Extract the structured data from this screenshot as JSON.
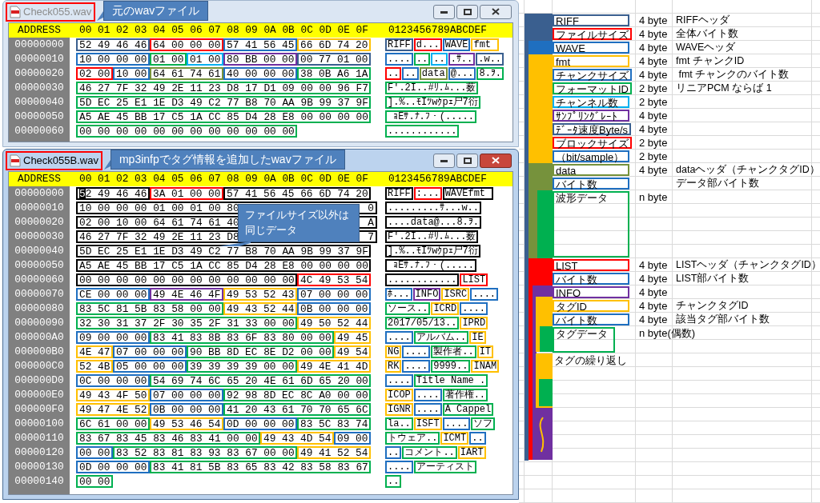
{
  "windows": [
    {
      "title": "Check055.wav",
      "active": false,
      "callout": "元のwavファイル",
      "header": {
        "address": "ADDRESS",
        "hex": "00 01 02 03 04 05 06 07 08 09 0A 0B 0C 0D 0E 0F",
        "ascii": "0123456789ABCDEF"
      },
      "rows": [
        {
          "address": "00000000",
          "hex": [
            {
              "text": "52 49 46 46",
              "color": "#3a5f8f"
            },
            {
              "text": "64 00 00 00",
              "color": "#ff0000"
            },
            {
              "text": "57 41 56 45",
              "color": "#1f6fc0"
            },
            {
              "text": "66 6D 74 20",
              "color": "#ffc000"
            }
          ],
          "ascii": [
            {
              "text": "RIFF",
              "color": "#3a5f8f"
            },
            {
              "text": "d...",
              "color": "#ff0000"
            },
            {
              "text": "WAVE",
              "color": "#1f6fc0"
            },
            {
              "text": "fmt ",
              "color": "#ffc000"
            }
          ]
        },
        {
          "address": "00000010",
          "hex": [
            {
              "text": "10 00 00 00",
              "color": "#1f6fc0"
            },
            {
              "text": "01 00",
              "color": "#00b050"
            },
            {
              "text": "01 00",
              "color": "#00b0f0"
            },
            {
              "text": "80 BB 00 00",
              "color": "#7030a0"
            },
            {
              "text": "00 77 01 00",
              "color": "#3a5f8f"
            }
          ],
          "ascii": [
            {
              "text": "....",
              "color": "#1f6fc0"
            },
            {
              "text": "..",
              "color": "#00b050"
            },
            {
              "text": "..",
              "color": "#00b0f0"
            },
            {
              "text": ".ｻ..",
              "color": "#7030a0"
            },
            {
              "text": ".w..",
              "color": "#3a5f8f"
            }
          ]
        },
        {
          "address": "00000020",
          "hex": [
            {
              "text": "02 00",
              "color": "#ff0000"
            },
            {
              "text": "10 00",
              "color": "#1f6fc0"
            },
            {
              "text": "64 61 74 61",
              "color": "#76923c"
            },
            {
              "text": "40 00 00 00",
              "color": "#1f6fc0"
            },
            {
              "text": "38 0B A6 1A",
              "color": "#00b050"
            }
          ],
          "ascii": [
            {
              "text": "..",
              "color": "#ff0000"
            },
            {
              "text": "..",
              "color": "#1f6fc0"
            },
            {
              "text": "data",
              "color": "#76923c"
            },
            {
              "text": "@...",
              "color": "#1f6fc0"
            },
            {
              "text": "8.ｦ.",
              "color": "#00b050"
            }
          ]
        },
        {
          "address": "00000030",
          "hex": [
            {
              "text": "46 27 7F 32 49 2E 11 23 D8 17 D1 09 00 00 96 F7",
              "color": "#00b050"
            }
          ],
          "ascii": [
            {
              "text": "F'.2I..#ﾘ.ﾑ...薮",
              "color": "#00b050"
            }
          ]
        },
        {
          "address": "00000040",
          "hex": [
            {
              "text": "5D EC 25 E1 1E D3 49 C2 77 B8 70 AA 9B 99 37 9F",
              "color": "#00b050"
            }
          ],
          "ascii": [
            {
              "text": "].%..ﾓIﾂwｸpｪ尸7衍",
              "color": "#00b050"
            }
          ]
        },
        {
          "address": "00000050",
          "hex": [
            {
              "text": "A5 AE 45 BB 17 C5 1A CC 85 D4 28 E8 00 00 00 00",
              "color": "#00b050"
            }
          ],
          "ascii": [
            {
              "text": " ｮEｻ.ﾅ.ﾌ・(.....",
              "color": "#00b050"
            }
          ]
        },
        {
          "address": "00000060",
          "hex": [
            {
              "text": "00 00 00 00 00 00 00 00 00 00 00 00",
              "color": "#00b050"
            }
          ],
          "ascii": [
            {
              "text": "............",
              "color": "#00b050"
            }
          ]
        }
      ]
    },
    {
      "title": "Check055B.wav",
      "active": true,
      "callout": "mp3infpでタグ情報を追加したwavファイル",
      "note": "ファイルサイズ以外は同じデータ",
      "header": {
        "address": "ADDRESS",
        "hex": "00 01 02 03 04 05 06 07 08 09 0A 0B 0C 0D 0E 0F",
        "ascii": "0123456789ABCDEF"
      },
      "rows": [
        {
          "address": "00000000",
          "hex": [
            {
              "text": "52 49 46 46",
              "color": "#000000",
              "cursor": true
            },
            {
              "text": "3A 01 00 00",
              "color": "#ff0000"
            },
            {
              "text": "57 41 56 45 66 6D 74 20",
              "color": "#000000"
            }
          ],
          "ascii": [
            {
              "text": "RIFF",
              "color": "#000000"
            },
            {
              "text": ":...",
              "color": "#ff0000"
            },
            {
              "text": "WAVEfmt ",
              "color": "#000000"
            }
          ]
        },
        {
          "address": "00000010",
          "hex": [
            {
              "text": "10 00 00 00 01 00 01 00 80",
              "tail": "0",
              "color": "#000000"
            }
          ],
          "ascii": [
            {
              "text": ".........ｻ...w..",
              "color": "#000000"
            }
          ]
        },
        {
          "address": "00000020",
          "hex": [
            {
              "text": "02 00 10 00 64 61 74 61 40",
              "tail": "A",
              "color": "#000000"
            }
          ],
          "ascii": [
            {
              "text": "....data@...8.ｦ.",
              "color": "#000000"
            }
          ]
        },
        {
          "address": "00000030",
          "hex": [
            {
              "text": "46 27 7F 32 49 2E 11 23 D8",
              "tail": "7",
              "color": "#000000"
            }
          ],
          "ascii": [
            {
              "text": "F'.2I..#ﾘ.ﾑ...薮",
              "color": "#000000"
            }
          ]
        },
        {
          "address": "00000040",
          "hex": [
            {
              "text": "5D EC 25 E1 1E D3 49 C2 77 B8 70 AA 9B 99 37 9F",
              "color": "#000000"
            }
          ],
          "ascii": [
            {
              "text": "].%..ﾓIﾂwｸpｪ尸7衍",
              "color": "#000000"
            }
          ]
        },
        {
          "address": "00000050",
          "hex": [
            {
              "text": "A5 AE 45 BB 17 C5 1A CC 85 D4 28 E8 00 00 00 00",
              "color": "#000000"
            }
          ],
          "ascii": [
            {
              "text": " ｮEｻ.ﾅ.ﾌ・(.....",
              "color": "#000000"
            }
          ]
        },
        {
          "address": "00000060",
          "hex": [
            {
              "text": "00 00 00 00 00 00 00 00 00 00 00 00",
              "color": "#000000"
            },
            {
              "text": "4C 49 53 54",
              "color": "#ff0000"
            }
          ],
          "ascii": [
            {
              "text": "............",
              "color": "#000000"
            },
            {
              "text": "LIST",
              "color": "#ff0000"
            }
          ]
        },
        {
          "address": "00000070",
          "hex": [
            {
              "text": "CE 00 00 00",
              "color": "#1f6fc0"
            },
            {
              "text": "49 4E 46 4F",
              "color": "#7030a0"
            },
            {
              "text": "49 53 52 43",
              "color": "#ffc000"
            },
            {
              "text": "07 00 00 00",
              "color": "#1f6fc0"
            }
          ],
          "ascii": [
            {
              "text": "ﾎ...",
              "color": "#1f6fc0"
            },
            {
              "text": "INFO",
              "color": "#7030a0"
            },
            {
              "text": "ISRC",
              "color": "#ffc000"
            },
            {
              "text": "....",
              "color": "#1f6fc0"
            }
          ]
        },
        {
          "address": "00000080",
          "hex": [
            {
              "text": "83 5C 81 5B 83 58 00 00",
              "color": "#00b050"
            },
            {
              "text": "49 43 52 44",
              "color": "#ffc000"
            },
            {
              "text": "0B 00 00 00",
              "color": "#1f6fc0"
            }
          ],
          "ascii": [
            {
              "text": "ソース..",
              "color": "#00b050"
            },
            {
              "text": "ICRD",
              "color": "#ffc000"
            },
            {
              "text": "....",
              "color": "#1f6fc0"
            }
          ]
        },
        {
          "address": "00000090",
          "hex": [
            {
              "text": "32 30 31 37 2F 30 35 2F 31 33 00 00",
              "color": "#00b050"
            },
            {
              "text": "49 50 52 44",
              "color": "#ffc000"
            }
          ],
          "ascii": [
            {
              "text": "2017/05/13..",
              "color": "#00b050"
            },
            {
              "text": "IPRD",
              "color": "#ffc000"
            }
          ]
        },
        {
          "address": "000000A0",
          "hex": [
            {
              "text": "09 00 00 00",
              "color": "#1f6fc0"
            },
            {
              "text": "83 41 83 8B 83 6F 83 80 00 00",
              "color": "#00b050"
            },
            {
              "text": "49 45",
              "color": "#ffc000"
            }
          ],
          "ascii": [
            {
              "text": "....",
              "color": "#1f6fc0"
            },
            {
              "text": "アルバム..",
              "color": "#00b050"
            },
            {
              "text": "IE",
              "color": "#ffc000"
            }
          ]
        },
        {
          "address": "000000B0",
          "hex": [
            {
              "text": "4E 47",
              "color": "#ffc000"
            },
            {
              "text": "07 00 00 00",
              "color": "#1f6fc0"
            },
            {
              "text": "90 BB 8D EC 8E D2 00 00",
              "color": "#00b050"
            },
            {
              "text": "49 54",
              "color": "#ffc000"
            }
          ],
          "ascii": [
            {
              "text": "NG",
              "color": "#ffc000"
            },
            {
              "text": "....",
              "color": "#1f6fc0"
            },
            {
              "text": "製作者..",
              "color": "#00b050"
            },
            {
              "text": "IT",
              "color": "#ffc000"
            }
          ]
        },
        {
          "address": "000000C0",
          "hex": [
            {
              "text": "52 4B",
              "color": "#ffc000"
            },
            {
              "text": "05 00 00 00",
              "color": "#1f6fc0"
            },
            {
              "text": "39 39 39 39 00 00",
              "color": "#00b050"
            },
            {
              "text": "49 4E 41 4D",
              "color": "#ffc000"
            }
          ],
          "ascii": [
            {
              "text": "RK",
              "color": "#ffc000"
            },
            {
              "text": "....",
              "color": "#1f6fc0"
            },
            {
              "text": "9999..",
              "color": "#00b050"
            },
            {
              "text": "INAM",
              "color": "#ffc000"
            }
          ]
        },
        {
          "address": "000000D0",
          "hex": [
            {
              "text": "0C 00 00 00",
              "color": "#1f6fc0"
            },
            {
              "text": "54 69 74 6C 65 20 4E 61 6D 65 20 00",
              "color": "#00b050"
            }
          ],
          "ascii": [
            {
              "text": "....",
              "color": "#1f6fc0"
            },
            {
              "text": "Title Name .",
              "color": "#00b050"
            }
          ]
        },
        {
          "address": "000000E0",
          "hex": [
            {
              "text": "49 43 4F 50",
              "color": "#ffc000"
            },
            {
              "text": "07 00 00 00",
              "color": "#1f6fc0"
            },
            {
              "text": "92 98 8D EC 8C A0 00 00",
              "color": "#00b050"
            }
          ],
          "ascii": [
            {
              "text": "ICOP",
              "color": "#ffc000"
            },
            {
              "text": "....",
              "color": "#1f6fc0"
            },
            {
              "text": "著作権..",
              "color": "#00b050"
            }
          ]
        },
        {
          "address": "000000F0",
          "hex": [
            {
              "text": "49 47 4E 52",
              "color": "#ffc000"
            },
            {
              "text": "0B 00 00 00",
              "color": "#1f6fc0"
            },
            {
              "text": "41 20 43 61 70 70 65 6C",
              "color": "#00b050"
            }
          ],
          "ascii": [
            {
              "text": "IGNR",
              "color": "#ffc000"
            },
            {
              "text": "....",
              "color": "#1f6fc0"
            },
            {
              "text": "A Cappel",
              "color": "#00b050"
            }
          ]
        },
        {
          "address": "00000100",
          "hex": [
            {
              "text": "6C 61 00 00",
              "color": "#00b050"
            },
            {
              "text": "49 53 46 54",
              "color": "#ffc000"
            },
            {
              "text": "0D 00 00 00",
              "color": "#1f6fc0"
            },
            {
              "text": "83 5C 83 74",
              "color": "#00b050"
            }
          ],
          "ascii": [
            {
              "text": "la..",
              "color": "#00b050"
            },
            {
              "text": "ISFT",
              "color": "#ffc000"
            },
            {
              "text": "....",
              "color": "#1f6fc0"
            },
            {
              "text": "ソフ",
              "color": "#00b050"
            }
          ]
        },
        {
          "address": "00000110",
          "hex": [
            {
              "text": "83 67 83 45 83 46 83 41 00 00",
              "color": "#00b050"
            },
            {
              "text": "49 43 4D 54",
              "color": "#ffc000"
            },
            {
              "text": "09 00",
              "color": "#1f6fc0"
            }
          ],
          "ascii": [
            {
              "text": "トウェア..",
              "color": "#00b050"
            },
            {
              "text": "ICMT",
              "color": "#ffc000"
            },
            {
              "text": "..",
              "color": "#1f6fc0"
            }
          ]
        },
        {
          "address": "00000120",
          "hex": [
            {
              "text": "00 00",
              "color": "#1f6fc0"
            },
            {
              "text": "83 52 83 81 83 93 83 67 00 00",
              "color": "#00b050"
            },
            {
              "text": "49 41 52 54",
              "color": "#ffc000"
            }
          ],
          "ascii": [
            {
              "text": "..",
              "color": "#1f6fc0"
            },
            {
              "text": "コメント..",
              "color": "#00b050"
            },
            {
              "text": "IART",
              "color": "#ffc000"
            }
          ]
        },
        {
          "address": "00000130",
          "hex": [
            {
              "text": "0D 00 00 00",
              "color": "#1f6fc0"
            },
            {
              "text": "83 41 81 5B 83 65 83 42 83 58 83 67",
              "color": "#00b050"
            }
          ],
          "ascii": [
            {
              "text": "....",
              "color": "#1f6fc0"
            },
            {
              "text": "アーティスト",
              "color": "#00b050"
            }
          ]
        },
        {
          "address": "00000140",
          "hex": [
            {
              "text": "00 00",
              "color": "#00b050"
            }
          ],
          "ascii": [
            {
              "text": "..",
              "color": "#00b050"
            }
          ]
        }
      ]
    }
  ],
  "spreadsheet": {
    "items": [
      {
        "kind": "field",
        "name": "RIFF",
        "color": "#3a5f8f",
        "size": "4 byte",
        "description": "RIFFヘッダ"
      },
      {
        "kind": "field",
        "name": "ファイルサイズ",
        "color": "#ff0000",
        "size": "4 byte",
        "description": "全体バイト数"
      },
      {
        "kind": "field",
        "name": "WAVE",
        "color": "#1f6fc0",
        "size": "4 byte",
        "description": "WAVEヘッダ"
      },
      {
        "kind": "field",
        "name": "fmt",
        "color": "#ffc000",
        "size": "4 byte",
        "description": "fmt チャンクID"
      },
      {
        "kind": "field",
        "name": "チャンクサイズ",
        "color": "#1f6fc0",
        "size": "4 byte",
        "description": " fmt チャンクのバイト数"
      },
      {
        "kind": "field",
        "name": "フォーマットID",
        "color": "#00b050",
        "size": "2 byte",
        "description": "リニアPCM ならば 1"
      },
      {
        "kind": "field",
        "name": "チャンネル数",
        "color": "#00b0f0",
        "size": "2 byte"
      },
      {
        "kind": "field",
        "name": "ｻﾝﾌﾟﾘﾝｸﾞﾚｰﾄ",
        "color": "#7030a0",
        "size": "4 byte"
      },
      {
        "kind": "field",
        "name": "ﾃﾞｰﾀ速度Byte/s",
        "color": "#3a5f8f",
        "size": "4 byte"
      },
      {
        "kind": "field",
        "name": "ブロックサイズ",
        "color": "#ff0000",
        "size": "2 byte"
      },
      {
        "kind": "field",
        "name": "（bit/sample）",
        "color": "#1f6fc0",
        "size": "2 byte"
      },
      {
        "kind": "field",
        "name": "data",
        "color": "#76923c",
        "size": "4 byte",
        "description": "dataヘッダ（チャンクタグID）"
      },
      {
        "kind": "field",
        "name": "バイト数",
        "color": "#1f6fc0",
        "description": "データ部バイト数"
      },
      {
        "kind": "data_block",
        "name": "波形データ",
        "color": "#00b050",
        "size": "n byte"
      },
      {
        "kind": "field",
        "name": "LIST",
        "color": "#ff0000",
        "size": "4 byte",
        "description": "LISTヘッダ（チャンクタグID）"
      },
      {
        "kind": "field",
        "name": "バイト数",
        "color": "#1f6fc0",
        "size": "4 byte",
        "description": "LIST部バイト数"
      },
      {
        "kind": "field",
        "name": "INFO",
        "color": "#7030a0",
        "size": "4 byte"
      },
      {
        "kind": "field",
        "name": "タグID",
        "color": "#ffc000",
        "size": "4 byte",
        "description": "チャンクタグID"
      },
      {
        "kind": "field",
        "name": "バイト数",
        "color": "#1f6fc0",
        "size": "4 byte",
        "description": "該当タグ部バイト数"
      },
      {
        "kind": "tag_block",
        "name": "タグデータ",
        "color": "#00b050",
        "size": "n byte(偶数)"
      },
      {
        "kind": "note",
        "name": "タグの繰り返し"
      }
    ]
  }
}
